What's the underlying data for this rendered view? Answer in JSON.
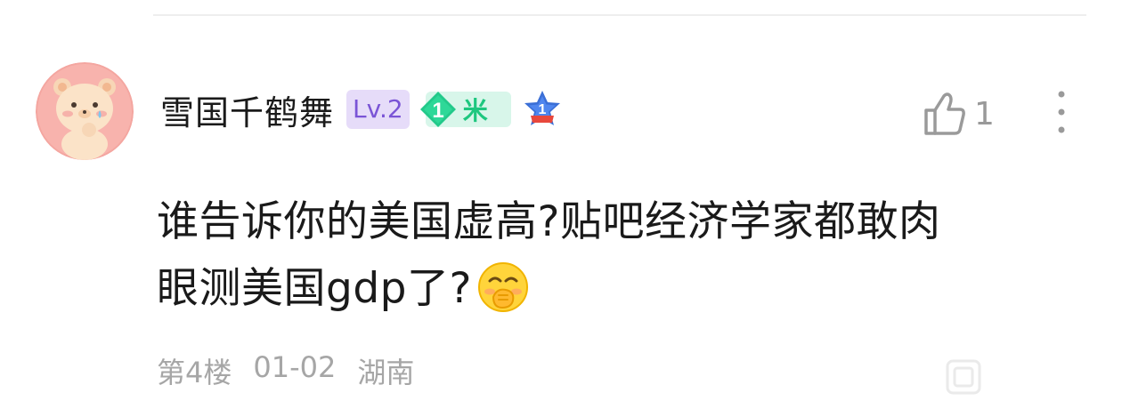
{
  "comment": {
    "user": {
      "name": "雪国千鹤舞",
      "level_badge": "Lv.2",
      "member_number": "1",
      "member_badge_text": "米",
      "star_badge_number": "1"
    },
    "like": {
      "count": "1"
    },
    "text_line1": "谁告诉你的美国虚高?贴吧经济学家都敢肉",
    "text_line2": "眼测美国gdp了?",
    "emoji": "covering-mouth-giggle-emoji",
    "meta": {
      "floor": "第4楼",
      "date": "01-02",
      "location": "湖南"
    }
  },
  "colors": {
    "level_badge_bg": "#e6dcf9",
    "level_badge_text": "#7a54d6",
    "member_green": "#1ec77f",
    "meta_gray": "#a6a6a6"
  },
  "icons": [
    "avatar-bear",
    "diamond-badge-icon",
    "star-badge-icon",
    "thumbs-up-icon",
    "more-vertical-icon",
    "emoji-icon"
  ]
}
